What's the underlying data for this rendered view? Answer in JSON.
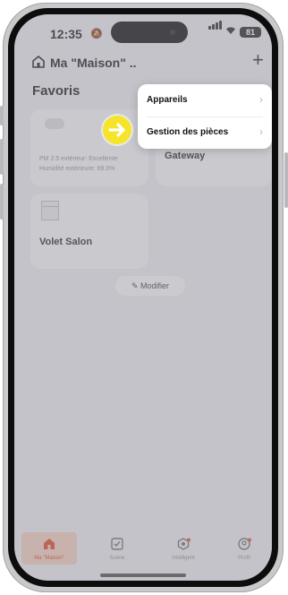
{
  "status": {
    "time": "12:35",
    "battery": "81"
  },
  "header": {
    "home_title": "Ma \"Maison\" ..",
    "plus": "+"
  },
  "favorites": {
    "title": "Favoris",
    "weather": {
      "pm": "PM 2.5 extérieur: Excellente",
      "humidity": "Humidité extérieure: 69.0%"
    },
    "gateway_label": "Mini Multi Mode Gateway",
    "shutter_label": "Volet Salon"
  },
  "modify_button": "Modifier",
  "menu": {
    "items": [
      {
        "label": "Appareils"
      },
      {
        "label": "Gestion des pièces"
      }
    ]
  },
  "tabs": [
    {
      "label": "Ma \"Maison\"",
      "icon": "home-icon"
    },
    {
      "label": "Scène",
      "icon": "checkbox-icon"
    },
    {
      "label": "Intelligent",
      "icon": "smart-icon"
    },
    {
      "label": "Profil",
      "icon": "profile-icon"
    }
  ],
  "colors": {
    "accent": "#d9411e",
    "marker": "#f5e42a"
  }
}
